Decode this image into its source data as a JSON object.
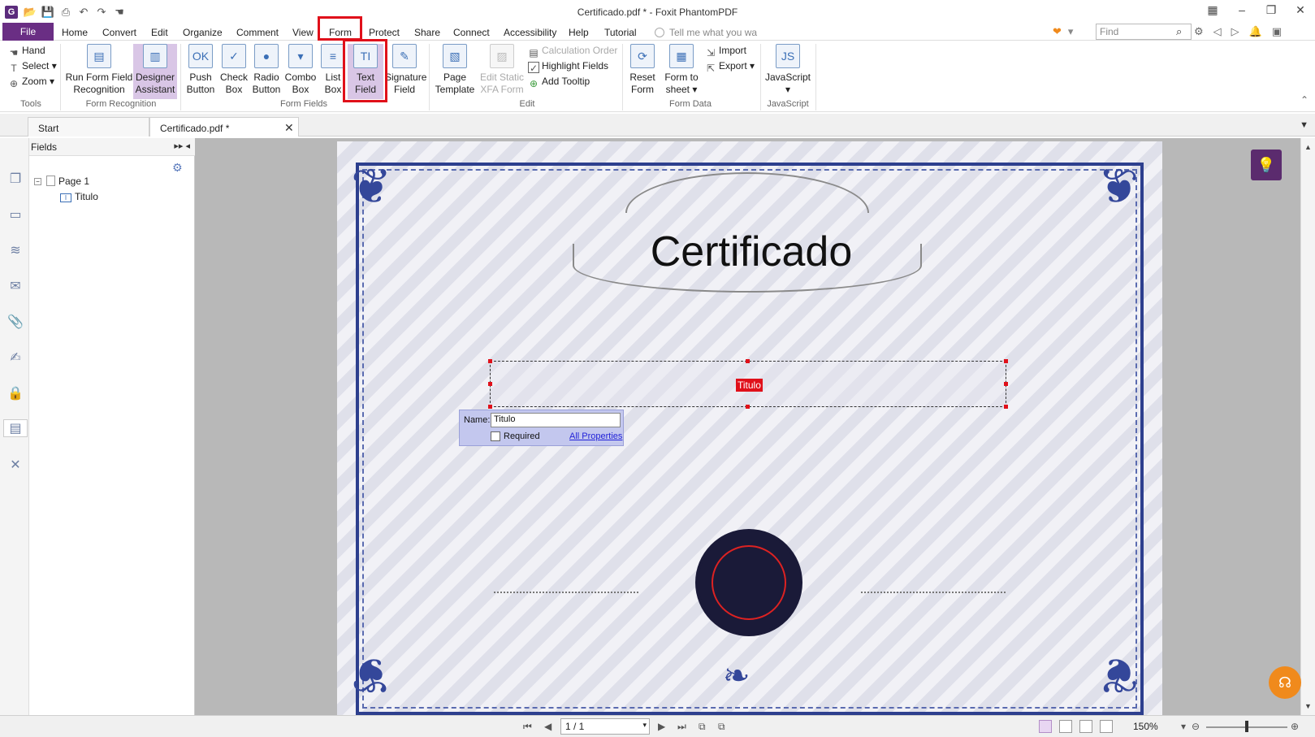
{
  "window": {
    "title": "Certificado.pdf * - Foxit PhantomPDF",
    "app_icon": "G",
    "quick_access": [
      "open-icon",
      "save-icon",
      "print-icon",
      "undo-icon",
      "redo-icon",
      "hand-tool-icon"
    ],
    "controls": [
      "grid-icon",
      "minimize-icon",
      "restore-icon",
      "close-icon"
    ]
  },
  "menu": {
    "file": "File",
    "items": [
      "Home",
      "Convert",
      "Edit",
      "Organize",
      "Comment",
      "View",
      "Form",
      "Protect",
      "Share",
      "Connect",
      "Accessibility",
      "Help",
      "Tutorial"
    ],
    "active": "Form",
    "tell_me": "Tell me what you wa",
    "find_placeholder": "Find"
  },
  "ribbon": {
    "tools": {
      "label": "Tools",
      "items": [
        {
          "label": "Hand",
          "icon": "hand-icon"
        },
        {
          "label": "Select",
          "icon": "select-icon"
        },
        {
          "label": "Zoom",
          "icon": "zoom-icon"
        }
      ]
    },
    "form_recognition": {
      "label": "Form Recognition",
      "run_form_field": [
        "Run Form Field",
        "Recognition"
      ],
      "designer_assistant": [
        "Designer",
        "Assistant"
      ]
    },
    "form_fields": {
      "label": "Form Fields",
      "buttons": [
        {
          "line1": "Push",
          "line2": "Button",
          "glyph": "OK"
        },
        {
          "line1": "Check",
          "line2": "Box",
          "glyph": "✓"
        },
        {
          "line1": "Radio",
          "line2": "Button",
          "glyph": "●"
        },
        {
          "line1": "Combo",
          "line2": "Box",
          "glyph": "▾"
        },
        {
          "line1": "List",
          "line2": "Box",
          "glyph": "≡"
        },
        {
          "line1": "Text",
          "line2": "Field",
          "glyph": "TI"
        },
        {
          "line1": "Signature",
          "line2": "Field",
          "glyph": "✎"
        }
      ]
    },
    "edit": {
      "label": "Edit",
      "page_template": [
        "Page",
        "Template"
      ],
      "edit_static": [
        "Edit Static",
        "XFA Form"
      ],
      "calculation_order": "Calculation Order",
      "highlight_fields": "Highlight Fields",
      "add_tooltip": "Add Tooltip"
    },
    "form_data": {
      "label": "Form Data",
      "reset_form": [
        "Reset",
        "Form"
      ],
      "form_to_sheet": [
        "Form to",
        "sheet"
      ],
      "import": "Import",
      "export": "Export"
    },
    "javascript": {
      "label": "JavaScript",
      "button": "JavaScript"
    }
  },
  "tabs": {
    "start": "Start",
    "document": "Certificado.pdf *"
  },
  "fields_panel": {
    "title": "Fields",
    "page_node": "Page 1",
    "field_node": "Titulo"
  },
  "certificate": {
    "heading": "Certificado",
    "field_label": "Titulo"
  },
  "field_popup": {
    "name_label": "Name:",
    "name_value": "Titulo",
    "required_label": "Required",
    "required_checked": false,
    "all_properties": "All Properties"
  },
  "statusbar": {
    "page_indicator": "1 / 1",
    "zoom": "150%"
  },
  "colors": {
    "accent": "#6a2e84",
    "highlight_box": "#e0101a",
    "cert_blue": "#2d3f8e"
  }
}
